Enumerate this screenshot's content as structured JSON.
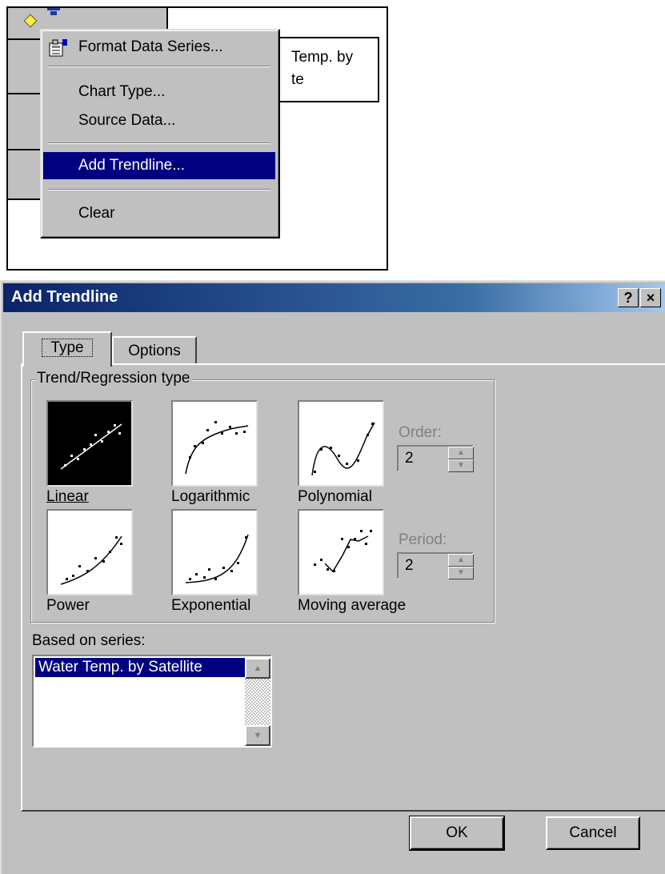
{
  "context_menu": {
    "items": [
      {
        "label": "Format Data Series...",
        "icon": "format-data-series-icon"
      },
      {
        "label": "Chart Type..."
      },
      {
        "label": "Source Data..."
      },
      {
        "label": "Add Trendline...",
        "highlighted": true
      },
      {
        "label": "Clear"
      }
    ]
  },
  "chart": {
    "legend_line1": "Temp. by",
    "legend_line2": "te"
  },
  "dialog": {
    "title": "Add Trendline",
    "help_icon": "?",
    "close_icon": "×",
    "tabs": [
      {
        "label": "Type",
        "active": true
      },
      {
        "label": "Options",
        "active": false
      }
    ],
    "group_title": "Trend/Regression type",
    "types": [
      {
        "label": "Linear",
        "selected": true
      },
      {
        "label": "Logarithmic"
      },
      {
        "label": "Polynomial"
      },
      {
        "label": "Power"
      },
      {
        "label": "Exponential"
      },
      {
        "label": "Moving average"
      }
    ],
    "order": {
      "label": "Order:",
      "value": "2"
    },
    "period": {
      "label": "Period:",
      "value": "2"
    },
    "series_label": "Based on series:",
    "series_list": [
      "Water Temp. by Satellite"
    ],
    "ok_label": "OK",
    "cancel_label": "Cancel"
  },
  "colors": {
    "face": "#c0c0c0",
    "highlight": "#000080",
    "title_start": "#0a246a",
    "title_end": "#a6caf0"
  }
}
